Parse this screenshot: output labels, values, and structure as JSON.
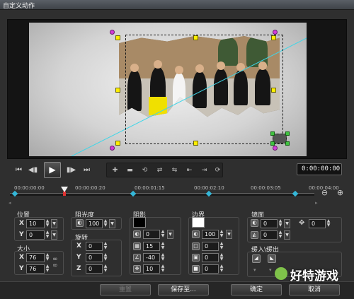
{
  "window": {
    "title": "自定义动作"
  },
  "transport": {
    "timecode": "0:00:00:00"
  },
  "timeline": {
    "labels": [
      "00:00:00:00",
      "00:00:00:20",
      "00:00:01:15",
      "00:00:02:10",
      "00:00:03:05",
      "00:00:04:00"
    ]
  },
  "position": {
    "title": "位置",
    "x_label": "X",
    "x_value": "10",
    "y_label": "Y",
    "y_value": "0"
  },
  "size": {
    "title": "大小",
    "x_label": "X",
    "x_value": "76",
    "y_label": "Y",
    "y_value": "76"
  },
  "opacity": {
    "title": "阻光度",
    "value": "100"
  },
  "rotation": {
    "title": "旋转",
    "x_label": "X",
    "x_value": "0",
    "y_label": "Y",
    "y_value": "0",
    "z_label": "Z",
    "z_value": "0"
  },
  "shadow": {
    "title": "阴影",
    "color": "#000000",
    "opacity_value": "0",
    "blur_value": "15",
    "angle_value": "-40",
    "distance_value": "10"
  },
  "border": {
    "title": "边界",
    "color": "#ffffff",
    "opacity_value": "100",
    "width_value": "0",
    "blur_value": "0",
    "fill_value": "0"
  },
  "mirror": {
    "title": "镜面",
    "opacity_value": "0",
    "blur_value": "0",
    "offset_value": "0",
    "distance_value": "0"
  },
  "easing": {
    "title": "缓入\\缓出"
  },
  "buttons": {
    "reset": "重置",
    "save_to": "保存至...",
    "ok": "确定",
    "cancel": "取消"
  },
  "watermark": {
    "text": "好特游戏"
  },
  "colors": {
    "keyframe": "#34b7d8",
    "guide_line": "#3fd6e8",
    "handle": "#ffef00",
    "corner_handle": "#d23bd8"
  }
}
